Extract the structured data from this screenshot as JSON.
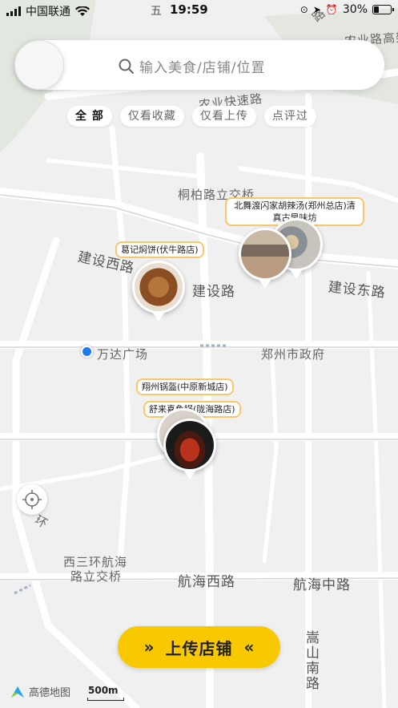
{
  "status_bar": {
    "carrier": "中国联通",
    "day": "五",
    "time": "19:59",
    "battery": "30%",
    "battery_level": 0.3
  },
  "search": {
    "placeholder": "输入美食/店铺/位置"
  },
  "filters": [
    {
      "label": "全 部",
      "active": true
    },
    {
      "label": "仅看收藏",
      "active": false
    },
    {
      "label": "仅看上传",
      "active": false
    },
    {
      "label": "点评过",
      "active": false
    }
  ],
  "map_labels": {
    "nongye_lu": "农业路高架",
    "nongye_kuaisu": "农业快速路",
    "tongbai_jiaoqiao": "桐柏路立交桥",
    "jianshe_xilu": "建设西路",
    "jianshe_lu": "建设路",
    "jianshe_donglu": "建设东路",
    "wanda": "万达广场",
    "zhengzhou_gov": "郑州市政府",
    "huan": "环",
    "xisanhuan_1": "西三环航海",
    "xisanhuan_2": "路立交桥",
    "hanghai_xilu": "航海西路",
    "hanghai_zhonglu": "航海中路",
    "songshan_nanlu": "嵩山南路",
    "top_road": "路"
  },
  "pins": [
    {
      "name": "北舞渡闪家胡辣汤(郑州总店)清真古早味坊"
    },
    {
      "name": "葛记焖饼(伏牛路店)"
    },
    {
      "name": "翔州锅盔(中原新城店)"
    },
    {
      "name": "舒来喜鱼锅(陇海路店)"
    }
  ],
  "upload_button": {
    "label": "上传店铺",
    "left_arrows": "»",
    "right_arrows": "«"
  },
  "map_logo": "高德地图",
  "scale": "500m",
  "colors": {
    "accent": "#f8c900",
    "pin_border": "#f7c86b",
    "user_location": "#1a7cf5"
  }
}
